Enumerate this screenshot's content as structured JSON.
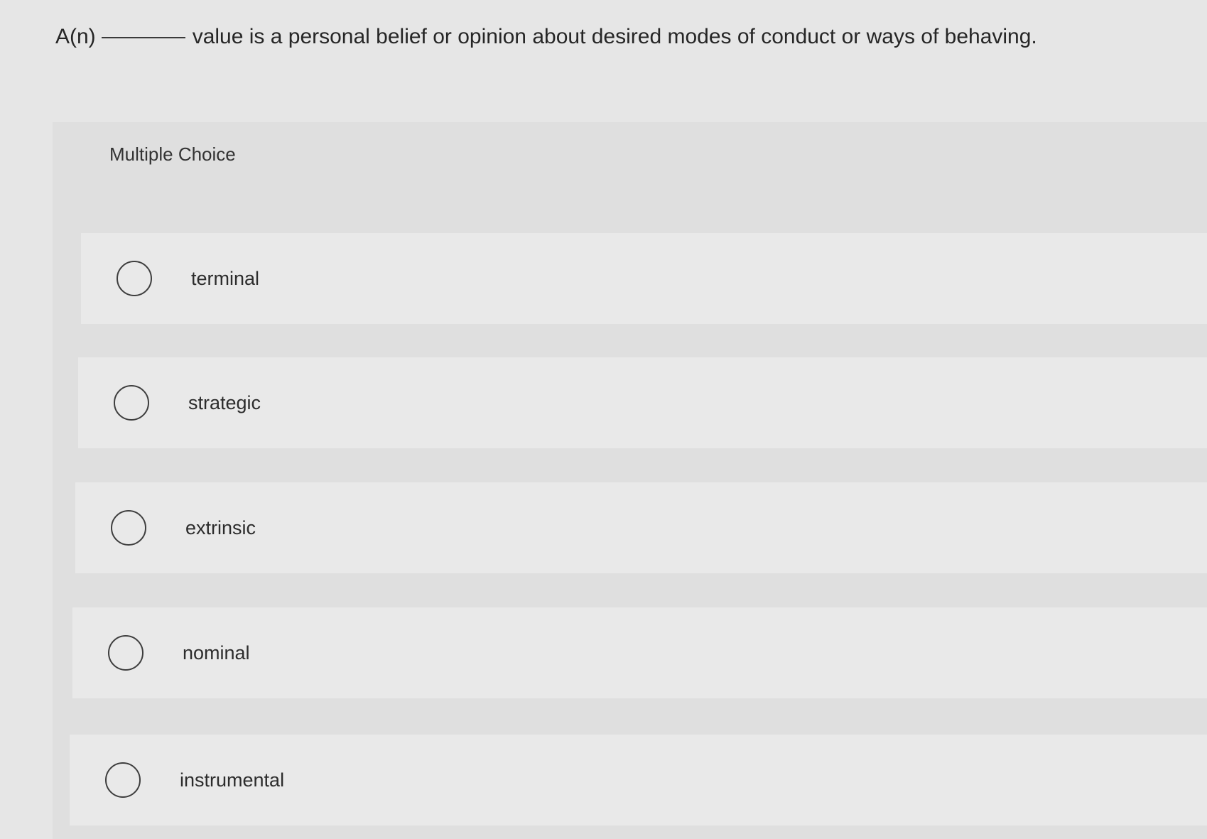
{
  "question": {
    "prefix": "A(n)",
    "suffix": "value is a personal belief or opinion about desired modes of conduct or ways of behaving."
  },
  "multiple_choice": {
    "label": "Multiple Choice",
    "options": [
      {
        "label": "terminal",
        "selected": false
      },
      {
        "label": "strategic",
        "selected": false
      },
      {
        "label": "extrinsic",
        "selected": false
      },
      {
        "label": "nominal",
        "selected": false
      },
      {
        "label": "instrumental",
        "selected": false
      }
    ]
  },
  "colors": {
    "page_background": "#e6e6e6",
    "panel_background": "#dfdfdf",
    "option_background": "#e9e9e9",
    "text": "#2b2b2b"
  }
}
